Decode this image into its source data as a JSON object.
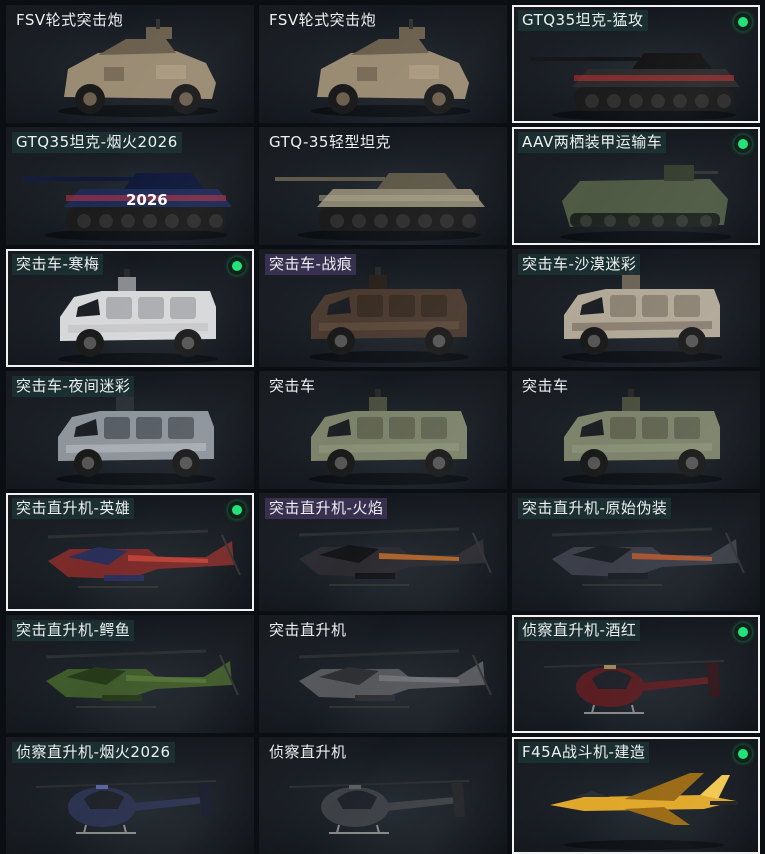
{
  "colors": {
    "selected_border": "#f2f2f2",
    "equipped_badge": "#23e27a",
    "label_bg_teal": "#1e3434",
    "label_bg_purple": "#403256"
  },
  "cards": [
    {
      "label": "FSV轮式突击炮",
      "icon": "wheeled-assault-gun",
      "selected": false,
      "equipped": false
    },
    {
      "label": "FSV轮式突击炮",
      "icon": "wheeled-assault-gun",
      "selected": false,
      "equipped": false
    },
    {
      "label": "GTQ35坦克-猛攻",
      "icon": "tank",
      "selected": true,
      "equipped": true
    },
    {
      "label": "GTQ35坦克-烟火2026",
      "icon": "tank",
      "selected": false,
      "equipped": false,
      "decal": "2026"
    },
    {
      "label": "GTQ-35轻型坦克",
      "icon": "tank",
      "selected": false,
      "equipped": false
    },
    {
      "label": "AAV两栖装甲运输车",
      "icon": "amphibious-apc",
      "selected": true,
      "equipped": true
    },
    {
      "label": "突击车-寒梅",
      "icon": "assault-vehicle",
      "selected": true,
      "equipped": true
    },
    {
      "label": "突击车-战痕",
      "icon": "assault-vehicle",
      "selected": false,
      "equipped": false
    },
    {
      "label": "突击车-沙漠迷彩",
      "icon": "assault-vehicle",
      "selected": false,
      "equipped": false
    },
    {
      "label": "突击车-夜间迷彩",
      "icon": "assault-vehicle",
      "selected": false,
      "equipped": false
    },
    {
      "label": "突击车",
      "icon": "assault-vehicle",
      "selected": false,
      "equipped": false
    },
    {
      "label": "突击车",
      "icon": "assault-vehicle",
      "selected": false,
      "equipped": false
    },
    {
      "label": "突击直升机-英雄",
      "icon": "attack-helicopter",
      "selected": true,
      "equipped": true
    },
    {
      "label": "突击直升机-火焰",
      "icon": "attack-helicopter",
      "selected": false,
      "equipped": false
    },
    {
      "label": "突击直升机-原始伪装",
      "icon": "attack-helicopter",
      "selected": false,
      "equipped": false
    },
    {
      "label": "突击直升机-鳄鱼",
      "icon": "attack-helicopter",
      "selected": false,
      "equipped": false
    },
    {
      "label": "突击直升机",
      "icon": "attack-helicopter",
      "selected": false,
      "equipped": false
    },
    {
      "label": "侦察直升机-酒红",
      "icon": "scout-helicopter",
      "selected": true,
      "equipped": true
    },
    {
      "label": "侦察直升机-烟火2026",
      "icon": "scout-helicopter",
      "selected": false,
      "equipped": false
    },
    {
      "label": "侦察直升机",
      "icon": "scout-helicopter",
      "selected": false,
      "equipped": false
    },
    {
      "label": "F45A战斗机-建造",
      "icon": "fighter-jet",
      "selected": true,
      "equipped": true
    }
  ]
}
